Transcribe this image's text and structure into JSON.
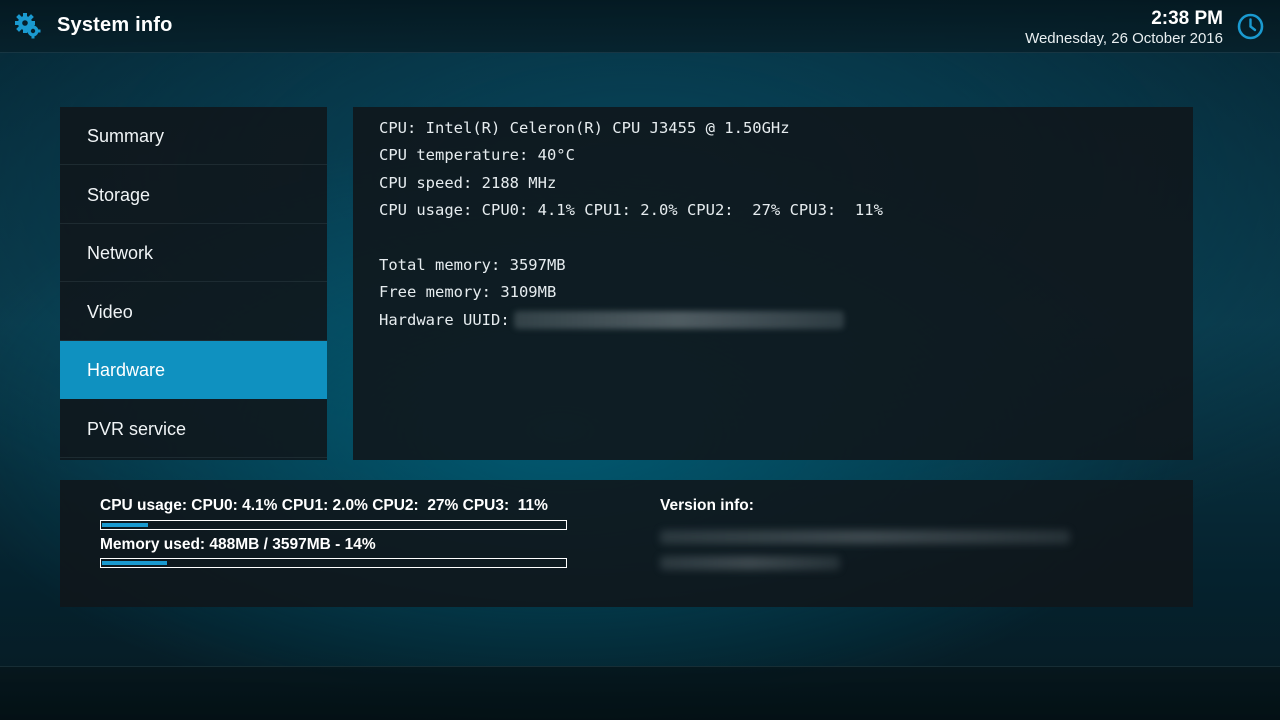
{
  "header": {
    "title": "System info",
    "time": "2:38 PM",
    "date": "Wednesday, 26 October 2016",
    "app_icon": "settings-gear-icon",
    "clock_icon": "clock-icon",
    "accent_color": "#1a9ad0"
  },
  "menu": {
    "items": [
      {
        "label": "Summary"
      },
      {
        "label": "Storage"
      },
      {
        "label": "Network"
      },
      {
        "label": "Video"
      },
      {
        "label": "Hardware"
      },
      {
        "label": "PVR service"
      }
    ],
    "active_index": 4,
    "active_color": "#0f91c0"
  },
  "info": {
    "cpu": "CPU: Intel(R) Celeron(R) CPU J3455 @ 1.50GHz",
    "cpu_temperature": "CPU temperature: 40°C",
    "cpu_speed": "CPU speed: 2188 MHz",
    "cpu_usage": "CPU usage: CPU0: 4.1% CPU1: 2.0% CPU2:  27% CPU3:  11%",
    "total_memory": "Total memory: 3597MB",
    "free_memory": "Free memory: 3109MB",
    "hardware_uuid_label": "Hardware UUID:"
  },
  "status": {
    "cpu_usage_label": "CPU usage: CPU0: 4.1% CPU1: 2.0% CPU2:  27% CPU3:  11%",
    "cpu_usage_fraction": 0.1,
    "memory_used_label": "Memory used: 488MB / 3597MB - 14%",
    "memory_used_fraction": 0.14,
    "version_label": "Version info:"
  }
}
